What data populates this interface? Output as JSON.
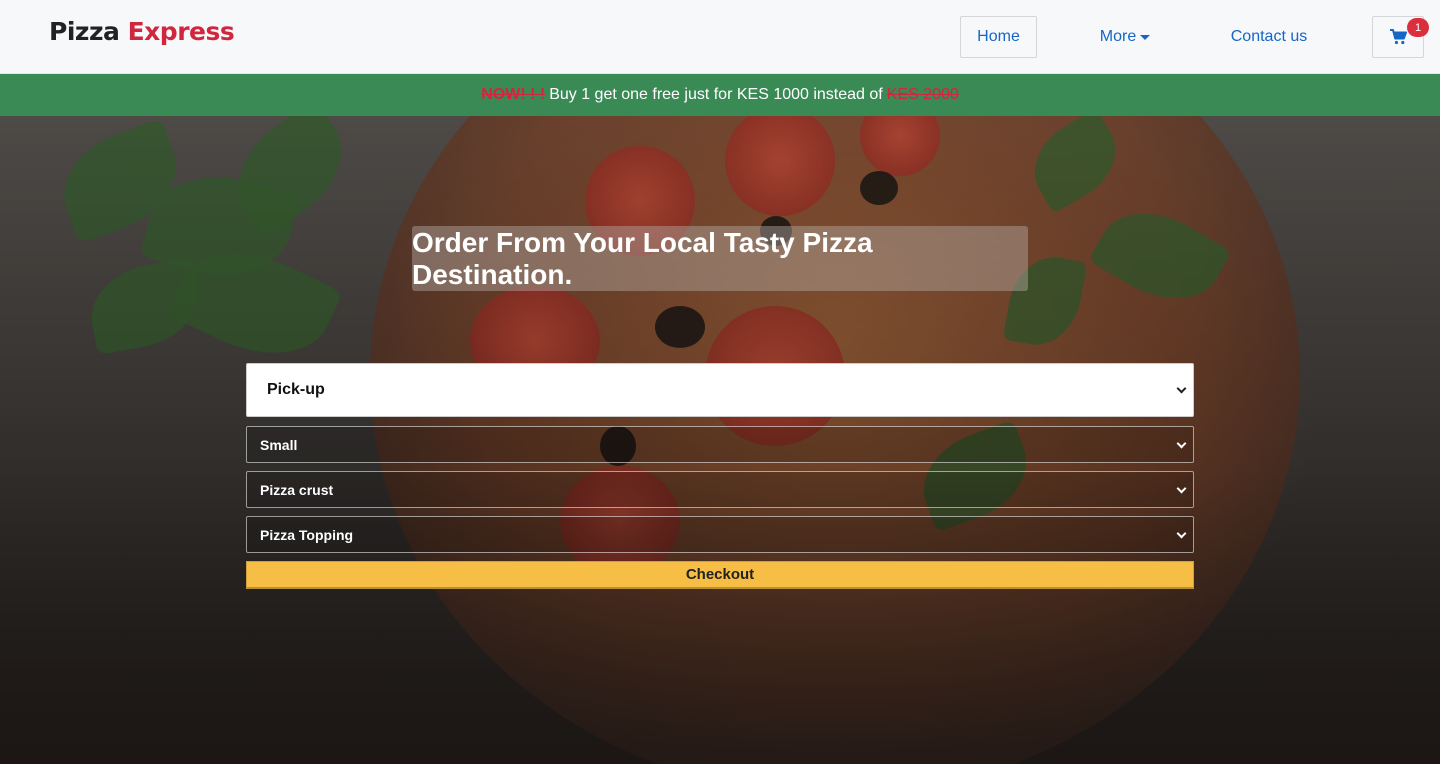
{
  "brand": {
    "part1": "Pizza",
    "part2": "Express"
  },
  "nav": {
    "home": "Home",
    "more": "More",
    "contact": "Contact us",
    "cart_icon": "shopping-cart-icon",
    "cart_count": "1"
  },
  "promo": {
    "now": "NOW! ! !",
    "text": "Buy 1 get one free just for KES 1000 instead of",
    "old_price": "KES 2000"
  },
  "hero": {
    "title": "Order From Your Local Tasty Pizza Destination."
  },
  "form": {
    "delivery": "Pick-up",
    "size": "Small",
    "crust": "Pizza crust",
    "topping": "Pizza Topping",
    "checkout": "Checkout"
  },
  "colors": {
    "brand_red": "#d0273e",
    "promo_green": "#3a8a55",
    "link_blue": "#1666c6",
    "checkout_yellow": "#f7be45"
  }
}
